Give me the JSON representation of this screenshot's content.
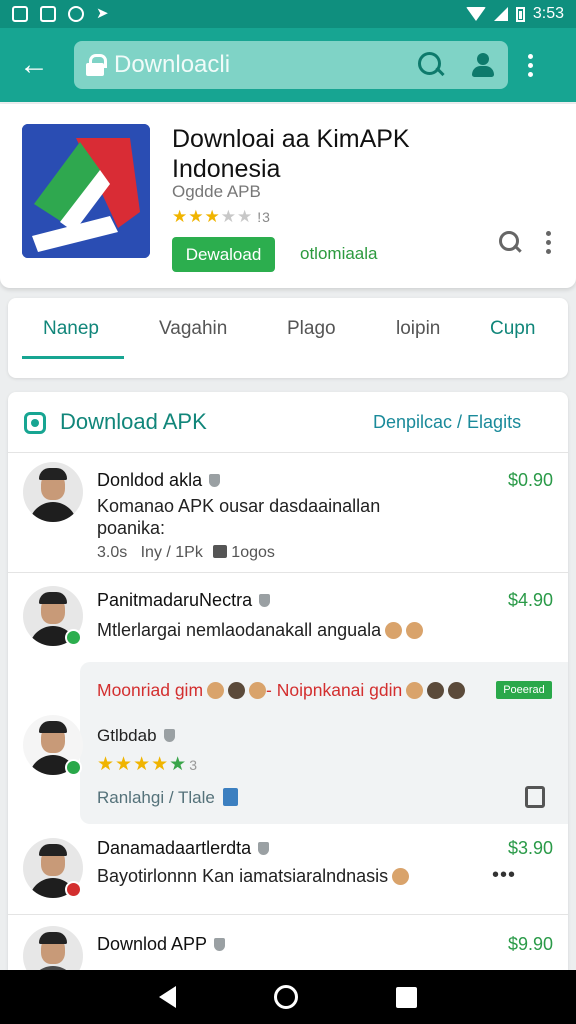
{
  "status_bar": {
    "time": "3:53"
  },
  "app_bar": {
    "search_text": "Downloacli"
  },
  "app": {
    "title": "Downloai aa KimAPK Indonesia",
    "subtitle": "Ogdde APB",
    "rating_value": "3",
    "rating_count": "!3",
    "install_label": "Dewaload",
    "secondary_link": "otlomiaala"
  },
  "tabs": [
    {
      "label": "Nanep",
      "active": true
    },
    {
      "label": "Vagahin",
      "active": false
    },
    {
      "label": "Plago",
      "active": false
    },
    {
      "label": "loipin",
      "active": false
    },
    {
      "label": "Cupn",
      "active": false
    }
  ],
  "section": {
    "title": "Download APK",
    "link": "Denpilcac / Elagits"
  },
  "rows": [
    {
      "name": "Donldod akla",
      "price": "$0.90",
      "text_line1": "Komanao APK ousar dasdaainallan",
      "text_line2": "poanika:",
      "meta_a": "3.0s",
      "meta_b": "Iny / 1Pk",
      "meta_c": "1ogos",
      "avatar_color": "#1e1e1e"
    },
    {
      "name": "PanitmadaruNectra",
      "price": "$4.90",
      "text": "Mtlerlargai nemlaodanakall anguala",
      "avatar_color": "#1e1e1e",
      "badge_color": "#2cae4e"
    },
    {
      "name": "Danamadaartlerdta",
      "price": "$3.90",
      "text": "Bayotirlonnn Kan iamatsiaralndnasis",
      "more": "•••",
      "avatar_color": "#1e1e1e",
      "badge_color": "#d32f2f"
    },
    {
      "name": "Downlod APP",
      "price": "$9.90",
      "avatar_color": "#4a4a4a"
    }
  ],
  "promo": {
    "headline_a": "Moonriad gim",
    "headline_b": "Noipnkanai gdin",
    "badge": "Poeerad",
    "name": "Gtlbdab",
    "rating": "3",
    "link": "Ranlahgi / Tlale",
    "avatar_color": "#ffffff"
  },
  "colors": {
    "status_bar": "#0f8f7e",
    "app_bar": "#17a592",
    "accent": "#11867a",
    "install": "#2cae4e",
    "price": "#2a9a48",
    "promo_headline": "#d32f2f"
  },
  "icons": [
    "back-arrow-icon",
    "lock-icon",
    "search-icon",
    "account-icon",
    "more-vert-icon",
    "download-section-icon",
    "shield-icon",
    "thumb-up-icon",
    "pin-icon",
    "bookmark-icon"
  ]
}
